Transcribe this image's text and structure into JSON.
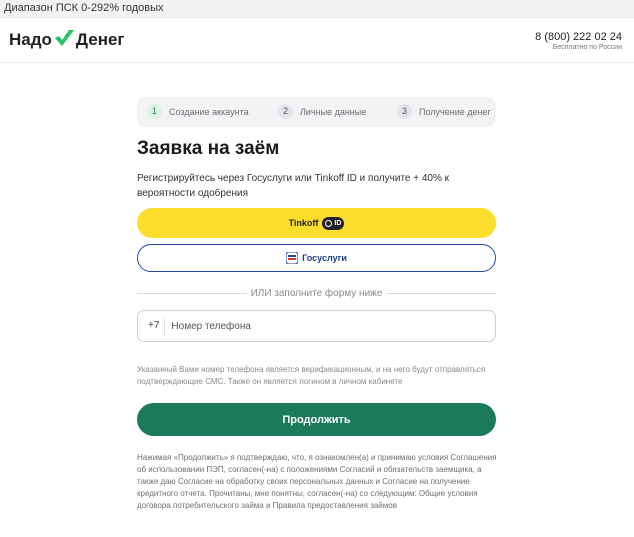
{
  "topbar": {
    "text": "Диапазон ПСК 0-292% годовых"
  },
  "header": {
    "logo_left": "Надо",
    "logo_right": "Денег",
    "phone": "8 (800) 222 02 24",
    "phone_note": "Бесплатно по России"
  },
  "steps": [
    {
      "num": "1",
      "label": "Создание аккаунта"
    },
    {
      "num": "2",
      "label": "Личные данные"
    },
    {
      "num": "3",
      "label": "Получение денег"
    }
  ],
  "form": {
    "title": "Заявка на заём",
    "subtitle": "Регистрируйтесь через Госуслуги или Tinkoff ID и получите + 40% к вероятности одобрения",
    "tinkoff_label": "Tinkoff",
    "tinkoff_badge": "ID",
    "gosuslugi_label": "Госуслуги",
    "divider_text": "ИЛИ заполните форму ниже",
    "phone_prefix": "+7",
    "phone_placeholder": "Номер телефона",
    "hint": "Указанный Вами номер телефона является верификационным, и на него будут отправляться подтверждающие СМС. Также он является логином в личном кабинете",
    "continue_label": "Продолжить",
    "legal": "Нажимая «Продолжить» я подтверждаю, что, я ознакомлен(а) и принимаю условия Соглашения об использовании ПЭП, согласен(-на) с положениями Согласий и обязательств заемщика, а также даю Согласие на обработку своих персональных данных и Согласие на получение кредитного отчета. Прочитаны, мне понятны, согласен(-на) со следующим: Общие условия договора потребительского займа и Правила предоставления займов"
  },
  "colors": {
    "brand_green": "#1b7a5a",
    "tinkoff_yellow": "#ffdd2d",
    "gos_blue": "#1f4aa8"
  },
  "icons": [
    "checkmark-logo-icon",
    "tinkoff-id-icon",
    "gosuslugi-icon"
  ]
}
